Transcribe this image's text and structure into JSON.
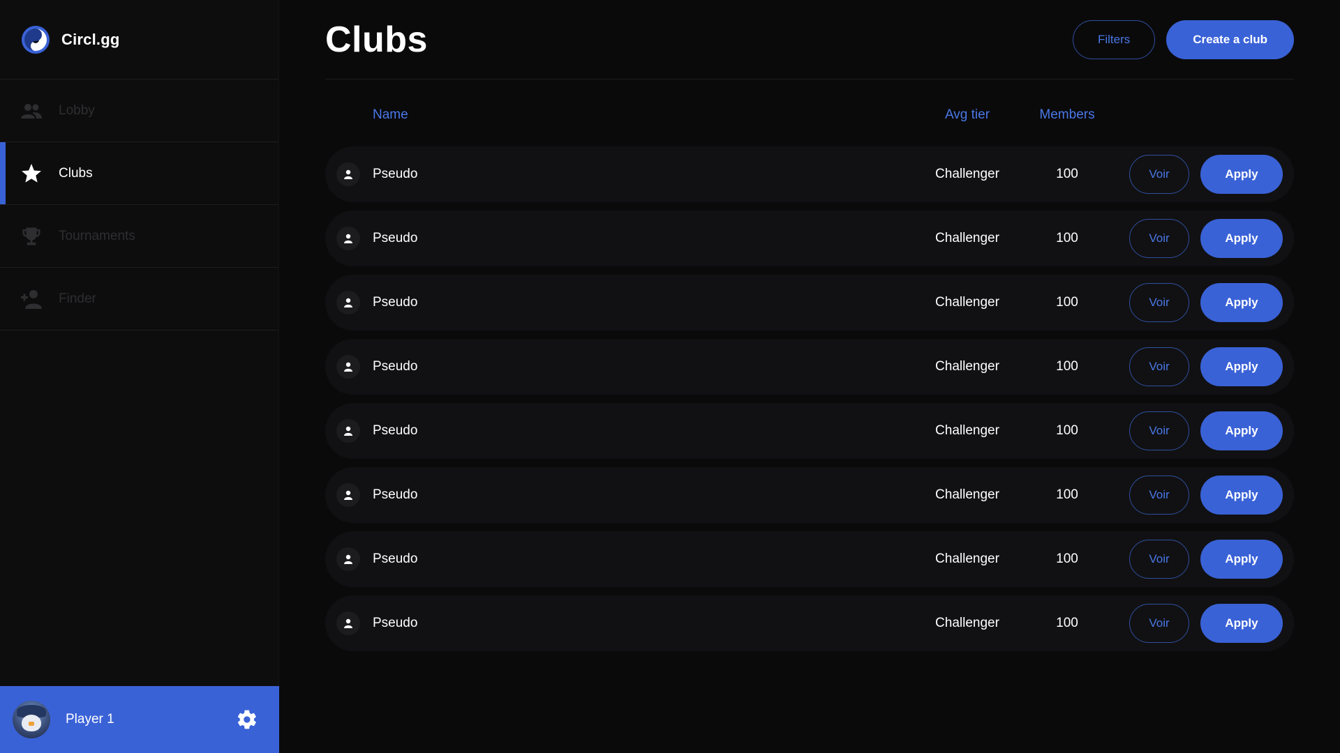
{
  "app": {
    "name": "Circl.gg",
    "accent": "#3a62d7"
  },
  "sidebar": {
    "items": [
      {
        "label": "Lobby",
        "icon": "group-icon",
        "active": false
      },
      {
        "label": "Clubs",
        "icon": "star-icon",
        "active": true
      },
      {
        "label": "Tournaments",
        "icon": "trophy-icon",
        "active": false
      },
      {
        "label": "Finder",
        "icon": "add-person-icon",
        "active": false
      }
    ],
    "user": {
      "name": "Player 1",
      "avatar": "penguin-avatar",
      "settings_icon": "gear-icon"
    }
  },
  "main": {
    "title": "Clubs",
    "filters_label": "Filters",
    "create_label": "Create a club",
    "table": {
      "headers": {
        "name": "Name",
        "tier": "Avg tier",
        "members": "Members"
      },
      "rows": [
        {
          "name": "Pseudo",
          "tier": "Challenger",
          "members": "100",
          "voir": "Voir",
          "apply": "Apply"
        },
        {
          "name": "Pseudo",
          "tier": "Challenger",
          "members": "100",
          "voir": "Voir",
          "apply": "Apply"
        },
        {
          "name": "Pseudo",
          "tier": "Challenger",
          "members": "100",
          "voir": "Voir",
          "apply": "Apply"
        },
        {
          "name": "Pseudo",
          "tier": "Challenger",
          "members": "100",
          "voir": "Voir",
          "apply": "Apply"
        },
        {
          "name": "Pseudo",
          "tier": "Challenger",
          "members": "100",
          "voir": "Voir",
          "apply": "Apply"
        },
        {
          "name": "Pseudo",
          "tier": "Challenger",
          "members": "100",
          "voir": "Voir",
          "apply": "Apply"
        },
        {
          "name": "Pseudo",
          "tier": "Challenger",
          "members": "100",
          "voir": "Voir",
          "apply": "Apply"
        },
        {
          "name": "Pseudo",
          "tier": "Challenger",
          "members": "100",
          "voir": "Voir",
          "apply": "Apply"
        }
      ]
    }
  }
}
